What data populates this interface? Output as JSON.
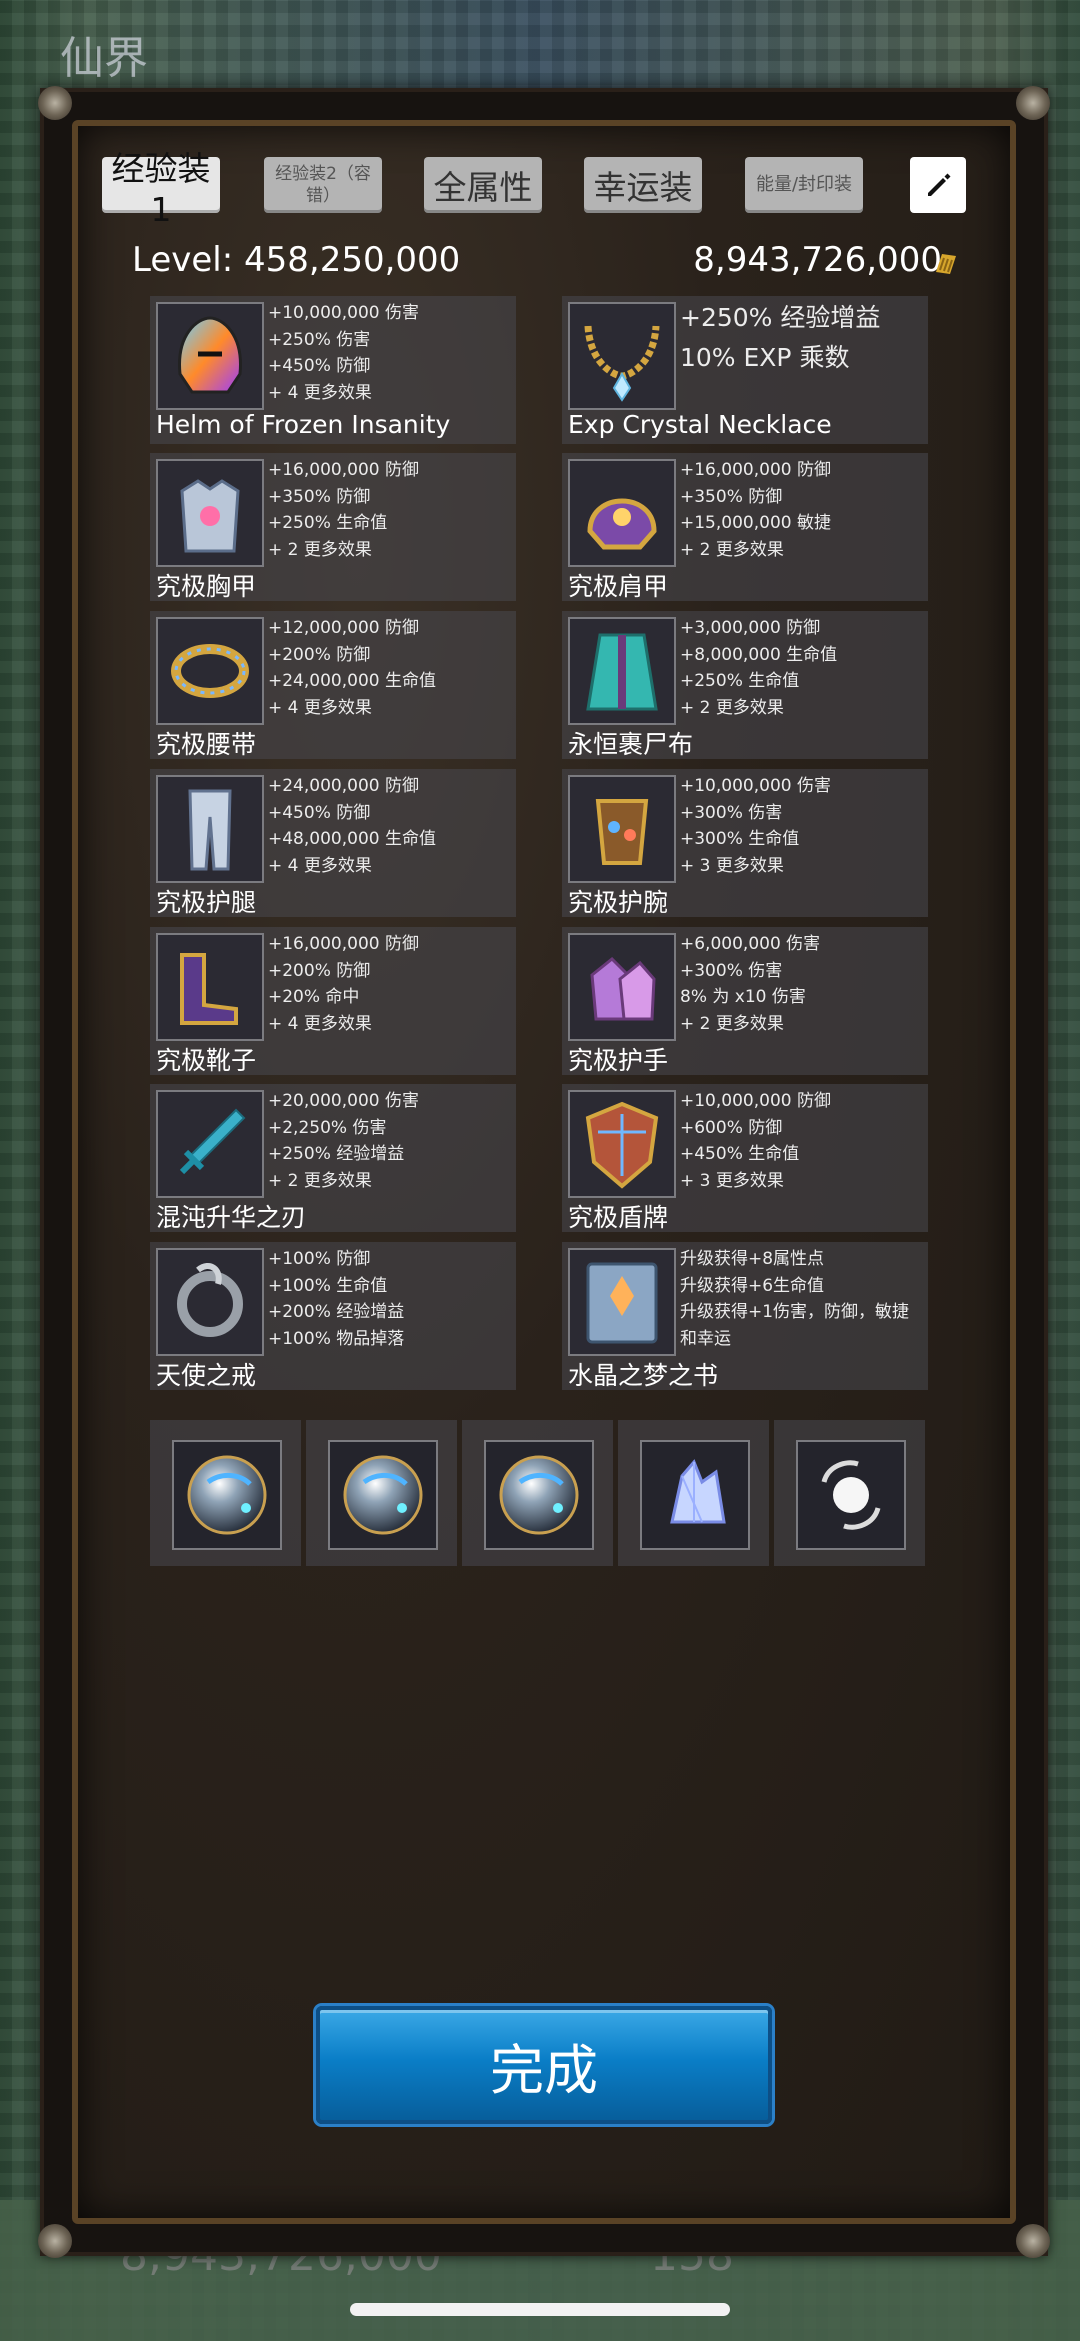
{
  "background": {
    "title": "仙界",
    "bottom_value": "8,943,726,000",
    "bottom_count": "158"
  },
  "tabs": [
    {
      "label": "经验装1",
      "active": true
    },
    {
      "label": "经验装2（容错）",
      "active": false
    },
    {
      "label": "全属性",
      "active": false
    },
    {
      "label": "幸运装",
      "active": false
    },
    {
      "label": "能量/封印装",
      "active": false
    }
  ],
  "edit_icon": "pencil-icon",
  "summary": {
    "level_label": "Level:",
    "level_value": "458,250,000",
    "gold_value": "8,943,726,000",
    "gold_icon": "gold-coin-icon"
  },
  "items": [
    {
      "name": "Helm of Frozen Insanity",
      "icon": "helm-icon",
      "stats": [
        "+10,000,000 伤害",
        "+250% 伤害",
        "+450% 防御",
        "+ 4 更多效果"
      ]
    },
    {
      "name": "Exp Crystal Necklace",
      "icon": "necklace-icon",
      "stats": [
        "+250% 经验增益",
        "10% EXP 乘数"
      ]
    },
    {
      "name": "究极胸甲",
      "icon": "chest-armor-icon",
      "stats": [
        "+16,000,000 防御",
        "+350% 防御",
        "+250% 生命值",
        "+ 2 更多效果"
      ]
    },
    {
      "name": "究极肩甲",
      "icon": "shoulder-armor-icon",
      "stats": [
        "+16,000,000 防御",
        "+350% 防御",
        "+15,000,000 敏捷",
        "+ 2 更多效果"
      ]
    },
    {
      "name": "究极腰带",
      "icon": "belt-icon",
      "stats": [
        "+12,000,000 防御",
        "+200% 防御",
        "+24,000,000 生命值",
        "+ 4 更多效果"
      ]
    },
    {
      "name": "永恒裹尸布",
      "icon": "cloak-icon",
      "stats": [
        "+3,000,000 防御",
        "+8,000,000 生命值",
        "+250% 生命值",
        "+ 2 更多效果"
      ]
    },
    {
      "name": "究极护腿",
      "icon": "leggings-icon",
      "stats": [
        "+24,000,000 防御",
        "+450% 防御",
        "+48,000,000 生命值",
        "+ 4 更多效果"
      ]
    },
    {
      "name": "究极护腕",
      "icon": "bracer-icon",
      "stats": [
        "+10,000,000 伤害",
        "+300% 伤害",
        "+300% 生命值",
        "+ 3 更多效果"
      ]
    },
    {
      "name": "究极靴子",
      "icon": "boots-icon",
      "stats": [
        "+16,000,000 防御",
        "+200% 防御",
        "+20% 命中",
        "+ 4 更多效果"
      ]
    },
    {
      "name": "究极护手",
      "icon": "gauntlets-icon",
      "stats": [
        "+6,000,000 伤害",
        "+300% 伤害",
        "8% 为 x10 伤害",
        "+ 2 更多效果"
      ]
    },
    {
      "name": "混沌升华之刃",
      "icon": "dagger-icon",
      "stats": [
        "+20,000,000 伤害",
        "+2,250% 伤害",
        "+250% 经验增益",
        "+ 2 更多效果"
      ]
    },
    {
      "name": "究极盾牌",
      "icon": "shield-icon",
      "stats": [
        "+10,000,000 防御",
        "+600% 防御",
        "+450% 生命值",
        "+ 3 更多效果"
      ]
    },
    {
      "name": "天使之戒",
      "icon": "ring-icon",
      "stats": [
        "+100% 防御",
        "+100% 生命值",
        "+200% 经验增益",
        "+100% 物品掉落"
      ]
    },
    {
      "name": "水晶之梦之书",
      "icon": "book-icon",
      "stats": [
        "升级获得+8属性点",
        "升级获得+6生命值",
        "升级获得+1伤害，防御，敏捷和幸运"
      ]
    }
  ],
  "slots": [
    {
      "icon": "orb-icon"
    },
    {
      "icon": "orb-icon"
    },
    {
      "icon": "orb-icon"
    },
    {
      "icon": "crystal-icon"
    },
    {
      "icon": "pearl-icon"
    }
  ],
  "done_button": "完成",
  "colors": {
    "accent_blue": "#0a7ec7",
    "frame_gold": "#5a4326",
    "panel": "#2a221b"
  }
}
